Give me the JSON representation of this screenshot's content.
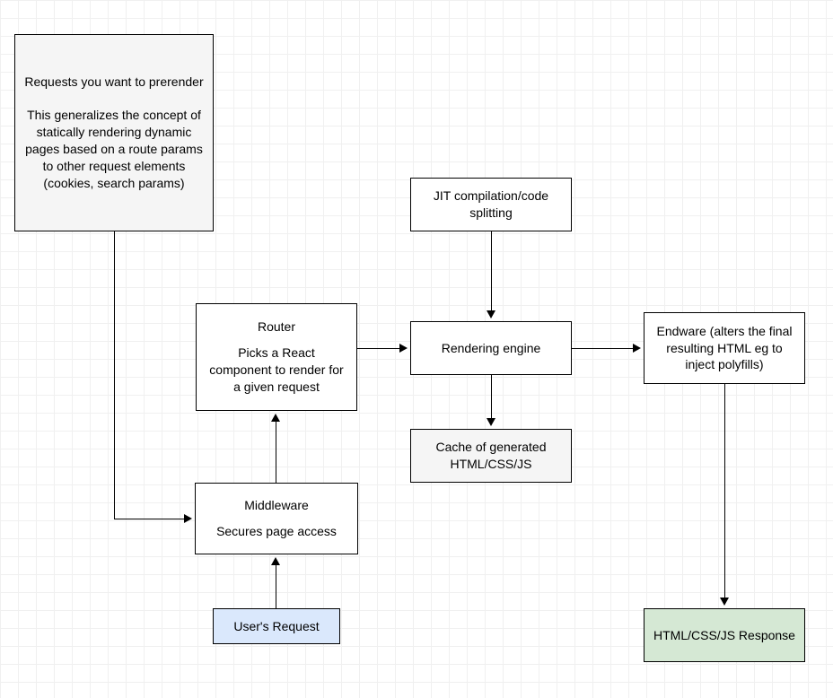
{
  "nodes": {
    "prerender": {
      "line1": "Requests you want to prerender",
      "line2": "This generalizes the concept of statically rendering dynamic pages based on a route params to other request elements (cookies, search params)"
    },
    "router": {
      "title": "Router",
      "desc": "Picks a React component to render for a given request"
    },
    "jit": {
      "text": "JIT compilation/code splitting"
    },
    "rendering": {
      "text": "Rendering engine"
    },
    "endware": {
      "text": "Endware (alters the final resulting HTML eg to inject polyfills)"
    },
    "cache": {
      "text": "Cache of generated HTML/CSS/JS"
    },
    "middleware": {
      "title": "Middleware",
      "desc": "Secures page access"
    },
    "userreq": {
      "text": "User's Request"
    },
    "response": {
      "text": "HTML/CSS/JS Response"
    }
  },
  "edges": [
    {
      "from": "prerender",
      "to": "middleware"
    },
    {
      "from": "userreq",
      "to": "middleware"
    },
    {
      "from": "middleware",
      "to": "router"
    },
    {
      "from": "router",
      "to": "rendering"
    },
    {
      "from": "jit",
      "to": "rendering"
    },
    {
      "from": "rendering",
      "to": "cache"
    },
    {
      "from": "rendering",
      "to": "endware"
    },
    {
      "from": "endware",
      "to": "response"
    }
  ]
}
